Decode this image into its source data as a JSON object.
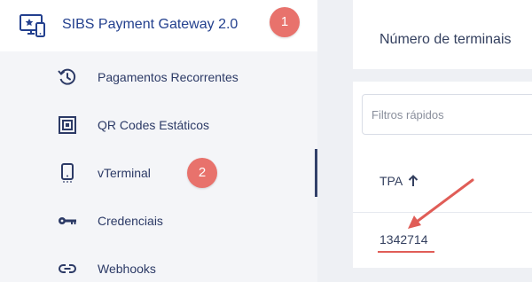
{
  "sidebar": {
    "main_item": {
      "label": "SIBS Payment Gateway 2.0",
      "icon": "monitor-star-icon",
      "badge": "1"
    },
    "items": [
      {
        "label": "Pagamentos Recorrentes",
        "icon": "recurring-clock-icon"
      },
      {
        "label": "QR Codes Estáticos",
        "icon": "qr-code-icon"
      },
      {
        "label": "vTerminal",
        "icon": "mobile-terminal-icon",
        "badge": "2"
      },
      {
        "label": "Credenciais",
        "icon": "key-icon"
      },
      {
        "label": "Webhooks",
        "icon": "link-icon"
      }
    ]
  },
  "main": {
    "terminals_card": {
      "label": "Número de terminais"
    },
    "table": {
      "filter_placeholder": "Filtros rápidos",
      "columns": [
        {
          "label": "TPA",
          "sort": "ascending"
        }
      ],
      "rows": [
        {
          "tpa": "1342714"
        }
      ]
    }
  },
  "colors": {
    "accent": "#23408e",
    "badge": "#e8726c",
    "annotation": "#e05d57",
    "sidebar_bg": "#f4f5f8",
    "content_bg": "#eef0f4"
  }
}
